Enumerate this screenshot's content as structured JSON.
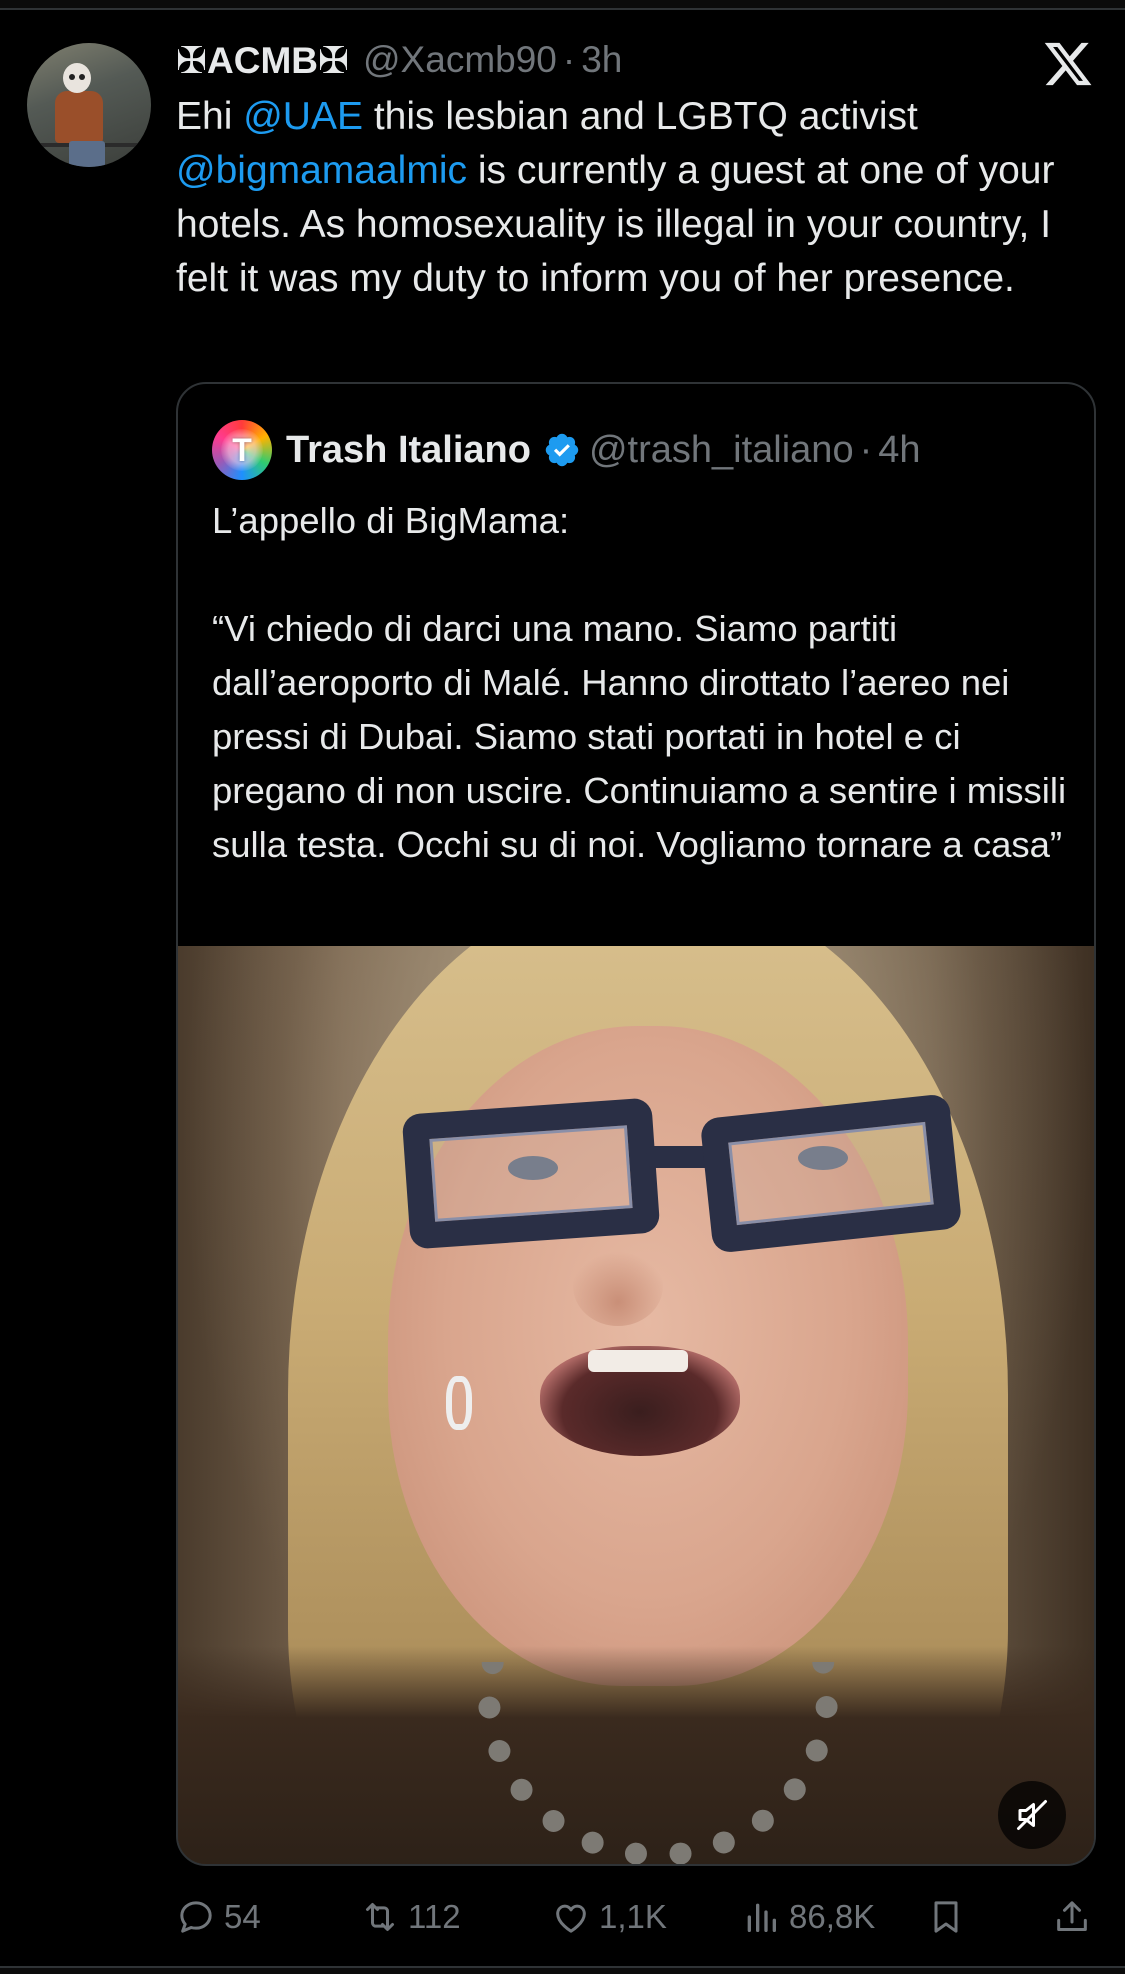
{
  "tweet": {
    "author": {
      "display_name": "✠ACMB✠",
      "handle": "@Xacmb90",
      "separator": "·",
      "time": "3h"
    },
    "text_parts": {
      "t1": "Ehi ",
      "m1": "@UAE",
      "t2": " this lesbian and LGBTQ activist ",
      "m2": "@bigmamaalmic",
      "t3": " is currently a guest at one of your hotels. As homosexuality is illegal in your country, I felt it was my duty to inform you of her presence."
    },
    "quote": {
      "avatar_letter": "T",
      "display_name": "Trash Italiano",
      "handle": "@trash_italiano",
      "separator": "·",
      "time": "4h",
      "text": "L’appello di BigMama:\n\n“Vi chiedo di darci una mano. Siamo partiti dall’aeroporto di Malé. Hanno dirottato l’aereo nei pressi di Dubai. Siamo stati portati in hotel e ci pregano di non uscire. Continuiamo a sentire i missili sulla testa. Occhi su di noi. Vogliamo tornare a casa”"
    },
    "actions": {
      "replies": "54",
      "reposts": "112",
      "likes": "1,1K",
      "views": "86,8K"
    }
  },
  "icons": {
    "logo": "x-logo-icon",
    "verified": "verified-badge-icon",
    "mute": "muted-speaker-icon",
    "reply": "reply-icon",
    "repost": "repost-icon",
    "like": "heart-icon",
    "views": "views-chart-icon",
    "bookmark": "bookmark-icon",
    "share": "share-icon"
  },
  "colors": {
    "background": "#000000",
    "text": "#e7e9ea",
    "secondary": "#71767b",
    "link": "#1d9bf0",
    "verified": "#1d9bf0",
    "border": "#2f3336"
  }
}
